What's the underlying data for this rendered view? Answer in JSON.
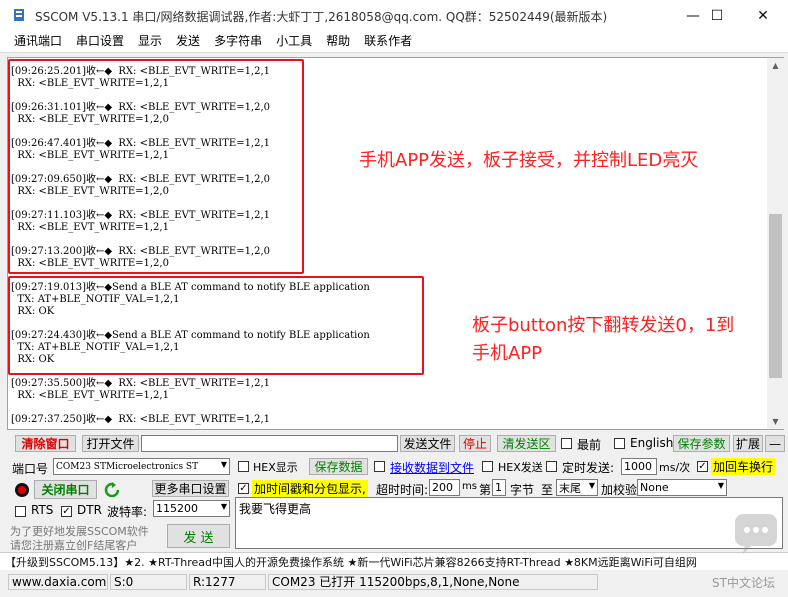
{
  "window": {
    "title": "SSCOM V5.13.1 串口/网络数据调试器,作者:大虾丁丁,2618058@qq.com. QQ群：52502449(最新版本)",
    "minimize": "—",
    "maximize": "☐",
    "close": "✕"
  },
  "menu": [
    "通讯端口",
    "串口设置",
    "显示",
    "发送",
    "多字符串",
    "小工具",
    "帮助",
    "联系作者"
  ],
  "log_lines": [
    "[09:26:25.201]收←◆  RX: <BLE_EVT_WRITE=1,2,1",
    "  RX: <BLE_EVT_WRITE=1,2,1",
    "",
    "[09:26:31.101]收←◆  RX: <BLE_EVT_WRITE=1,2,0",
    "  RX: <BLE_EVT_WRITE=1,2,0",
    "",
    "[09:26:47.401]收←◆  RX: <BLE_EVT_WRITE=1,2,1",
    "  RX: <BLE_EVT_WRITE=1,2,1",
    "",
    "[09:27:09.650]收←◆  RX: <BLE_EVT_WRITE=1,2,0",
    "  RX: <BLE_EVT_WRITE=1,2,0",
    "",
    "[09:27:11.103]收←◆  RX: <BLE_EVT_WRITE=1,2,1",
    "  RX: <BLE_EVT_WRITE=1,2,1",
    "",
    "[09:27:13.200]收←◆  RX: <BLE_EVT_WRITE=1,2,0",
    "  RX: <BLE_EVT_WRITE=1,2,0",
    "",
    "[09:27:19.013]收←◆Send a BLE AT command to notify BLE application",
    "  TX: AT+BLE_NOTIF_VAL=1,2,1",
    "  RX: OK",
    "",
    "[09:27:24.430]收←◆Send a BLE AT command to notify BLE application",
    "  TX: AT+BLE_NOTIF_VAL=1,2,1",
    "  RX: OK",
    "",
    "[09:27:35.500]收←◆  RX: <BLE_EVT_WRITE=1,2,1",
    "  RX: <BLE_EVT_WRITE=1,2,1",
    "",
    "[09:27:37.250]收←◆  RX: <BLE_EVT_WRITE=1,2,1"
  ],
  "annotations": {
    "top": "手机APP发送，板子接受，并控制LED亮灭",
    "bottom_line1": "板子button按下翻转发送0，1到",
    "bottom_line2": "手机APP"
  },
  "toolbar": {
    "clear_window": "清除窗口",
    "open_file": "打开文件",
    "send_file": "发送文件",
    "stop": "停止",
    "send_area": "清发送区",
    "front": "最前",
    "english": "English",
    "save_params": "保存参数",
    "expand": "扩展",
    "collapse": "—"
  },
  "port": {
    "label": "端口号",
    "value": "COM23 STMicroelectronics ST",
    "hex_display": "HEX显示",
    "save_data": "保存数据",
    "recv_to_file": "接收数据到文件",
    "hex_send": "HEX发送",
    "timed_send": "定时发送:",
    "interval": "1000",
    "interval_unit": "ms/次",
    "add_crlf": "加回车换行"
  },
  "row2": {
    "close_port": "关闭串口",
    "more_settings": "更多串口设置",
    "timestamp": "加时间戳和分包显示,",
    "timeout_label": "超时时间:",
    "timeout_value": "200",
    "timeout_unit": "ms",
    "byte_no_prefix": "第",
    "byte_no": "1",
    "byte_label": "字节",
    "to_label": "至",
    "to_value": "末尾",
    "checksum_label": "加校验",
    "checksum_value": "None"
  },
  "row3": {
    "rts": "RTS",
    "dtr": "DTR",
    "baud_label": "波特率:",
    "baud_value": "115200"
  },
  "send": {
    "text": "我要飞得更高",
    "button": "发  送",
    "promo1": "为了更好地发展SSCOM软件",
    "promo2": "请您注册嘉立创F结尾客户"
  },
  "ticker": "【升级到SSCOM5.13】★2. ★RT-Thread中国人的开源免费操作系统 ★新一代WiFi芯片兼容8266支持RT-Thread ★8KM远距离WiFi可自组网",
  "status": {
    "url": "www.daxia.com",
    "s": "S:0",
    "r": "R:1277",
    "port_state": "COM23 已打开  115200bps,8,1,None,None",
    "watermark": "ST中文论坛"
  },
  "colors": {
    "annotation": "#ff2020",
    "box": "#e8121a",
    "highlight": "#ffff00"
  }
}
